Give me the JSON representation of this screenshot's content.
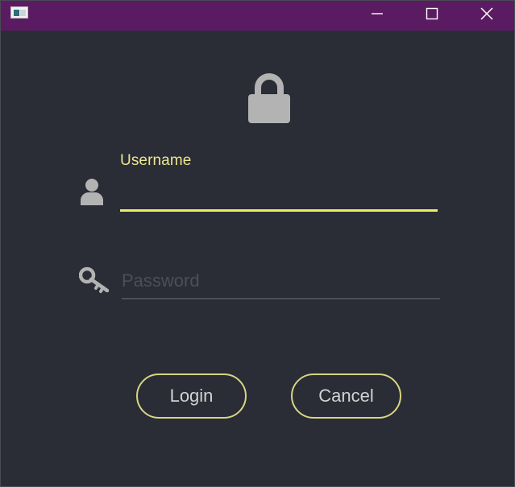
{
  "window": {
    "title": "",
    "icon": "app-window-icon",
    "controls": {
      "minimize": "minimize-icon",
      "maximize": "maximize-icon",
      "close": "close-icon"
    }
  },
  "colors": {
    "titlebar": "#5b1b62",
    "background": "#2a2c36",
    "accent": "#ecec66",
    "button_border": "#d6d583",
    "icon_gray": "#b3b3b3"
  },
  "header": {
    "icon": "lock-icon"
  },
  "form": {
    "username": {
      "icon": "user-icon",
      "label": "Username",
      "value": "",
      "placeholder": ""
    },
    "password": {
      "icon": "key-icon",
      "value": "",
      "placeholder": "Password"
    }
  },
  "buttons": {
    "login": "Login",
    "cancel": "Cancel"
  }
}
